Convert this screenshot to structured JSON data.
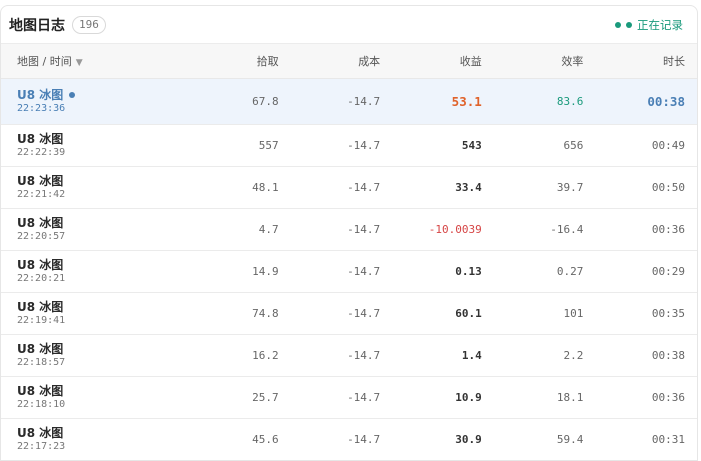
{
  "header": {
    "title": "地图日志",
    "count": "196",
    "status_label": "正在记录",
    "status_color": "#1a9a7c"
  },
  "columns": {
    "map_time": "地图 / 时间",
    "pickup": "拾取",
    "cost": "成本",
    "profit": "收益",
    "efficiency": "效率",
    "duration": "时长"
  },
  "rows": [
    {
      "map": "U8 冰图",
      "time": "22:23:36",
      "pickup": "67.8",
      "cost": "-14.7",
      "profit": "53.1",
      "efficiency": "83.6",
      "duration": "00:38",
      "active": true
    },
    {
      "map": "U8 冰图",
      "time": "22:22:39",
      "pickup": "557",
      "cost": "-14.7",
      "profit": "543",
      "efficiency": "656",
      "duration": "00:49"
    },
    {
      "map": "U8 冰图",
      "time": "22:21:42",
      "pickup": "48.1",
      "cost": "-14.7",
      "profit": "33.4",
      "efficiency": "39.7",
      "duration": "00:50"
    },
    {
      "map": "U8 冰图",
      "time": "22:20:57",
      "pickup": "4.7",
      "cost": "-14.7",
      "profit": "-10.0039",
      "efficiency": "-16.4",
      "duration": "00:36",
      "negative": true
    },
    {
      "map": "U8 冰图",
      "time": "22:20:21",
      "pickup": "14.9",
      "cost": "-14.7",
      "profit": "0.13",
      "efficiency": "0.27",
      "duration": "00:29"
    },
    {
      "map": "U8 冰图",
      "time": "22:19:41",
      "pickup": "74.8",
      "cost": "-14.7",
      "profit": "60.1",
      "efficiency": "101",
      "duration": "00:35"
    },
    {
      "map": "U8 冰图",
      "time": "22:18:57",
      "pickup": "16.2",
      "cost": "-14.7",
      "profit": "1.4",
      "efficiency": "2.2",
      "duration": "00:38"
    },
    {
      "map": "U8 冰图",
      "time": "22:18:10",
      "pickup": "25.7",
      "cost": "-14.7",
      "profit": "10.9",
      "efficiency": "18.1",
      "duration": "00:36"
    },
    {
      "map": "U8 冰图",
      "time": "22:17:23",
      "pickup": "45.6",
      "cost": "-14.7",
      "profit": "30.9",
      "efficiency": "59.4",
      "duration": "00:31"
    }
  ]
}
